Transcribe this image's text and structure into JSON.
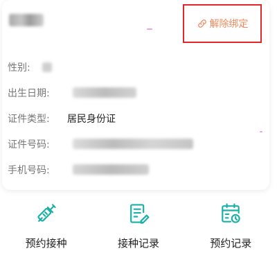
{
  "header": {
    "unbind_label": "解除绑定",
    "accent_color": "#f08a5d",
    "highlight_border_color": "#e0252b"
  },
  "info": [
    {
      "label": "性别:",
      "value": ""
    },
    {
      "label": "出生日期:",
      "value": ""
    },
    {
      "label": "证件类型:",
      "value": "居民身份证"
    },
    {
      "label": "证件号码:",
      "value": ""
    },
    {
      "label": "手机号码:",
      "value": ""
    }
  ],
  "actions": [
    {
      "label": "预约接种",
      "icon": "syringe-icon"
    },
    {
      "label": "接种记录",
      "icon": "document-edit-icon"
    },
    {
      "label": "预约记录",
      "icon": "calendar-clock-icon"
    }
  ],
  "icon_color": "#1ab0a6"
}
